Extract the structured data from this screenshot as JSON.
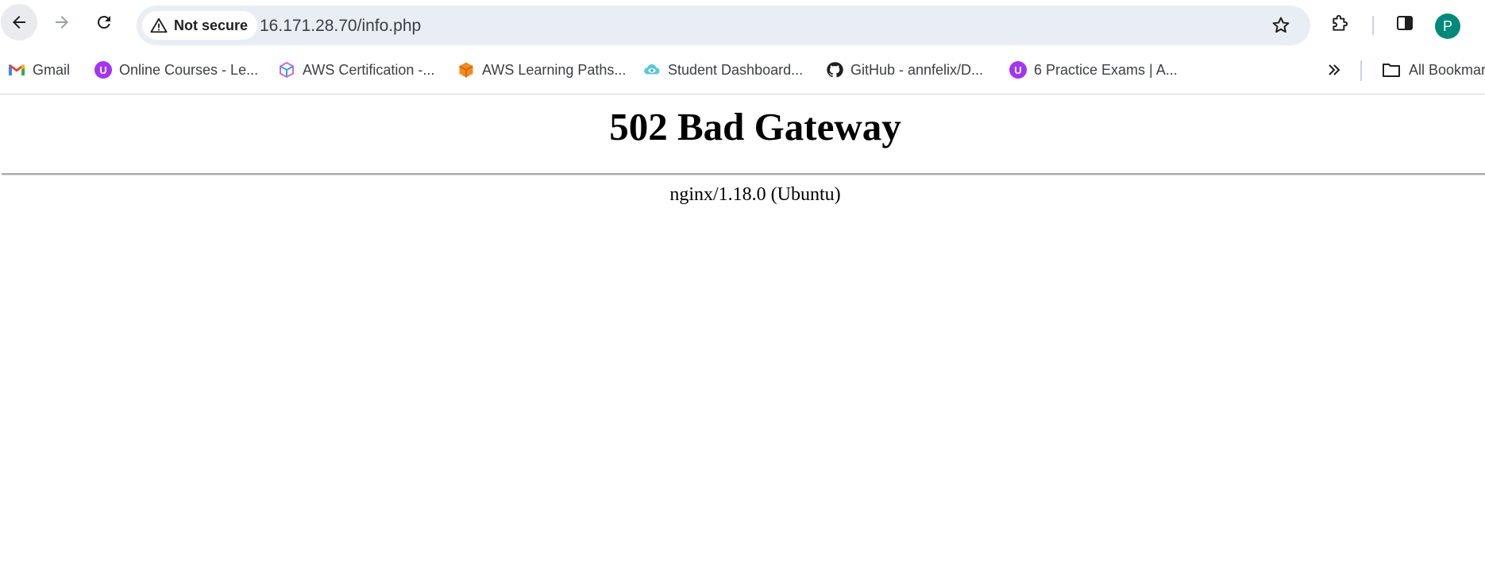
{
  "browser": {
    "security_label": "Not secure",
    "url": "16.171.28.70/info.php",
    "avatar_letter": "P"
  },
  "bookmarks": [
    {
      "label": "Gmail",
      "icon": "gmail-icon"
    },
    {
      "label": "Online Courses - Le...",
      "icon": "udemy-icon"
    },
    {
      "label": "AWS Certification -...",
      "icon": "aws-cert-cube-icon"
    },
    {
      "label": "AWS Learning Paths...",
      "icon": "aws-learning-cube-icon"
    },
    {
      "label": "Student Dashboard...",
      "icon": "cloud-eye-icon"
    },
    {
      "label": "GitHub - annfelix/D...",
      "icon": "github-icon"
    },
    {
      "label": "6 Practice Exams | A...",
      "icon": "udemy-icon"
    }
  ],
  "all_bookmarks_label": "All Bookmar",
  "page": {
    "title": "502 Bad Gateway",
    "server": "nginx/1.18.0 (Ubuntu)"
  },
  "colors": {
    "omnibox_bg": "#e9edf4",
    "avatar_bg": "#00897b",
    "udemy_purple": "#a435f0"
  }
}
